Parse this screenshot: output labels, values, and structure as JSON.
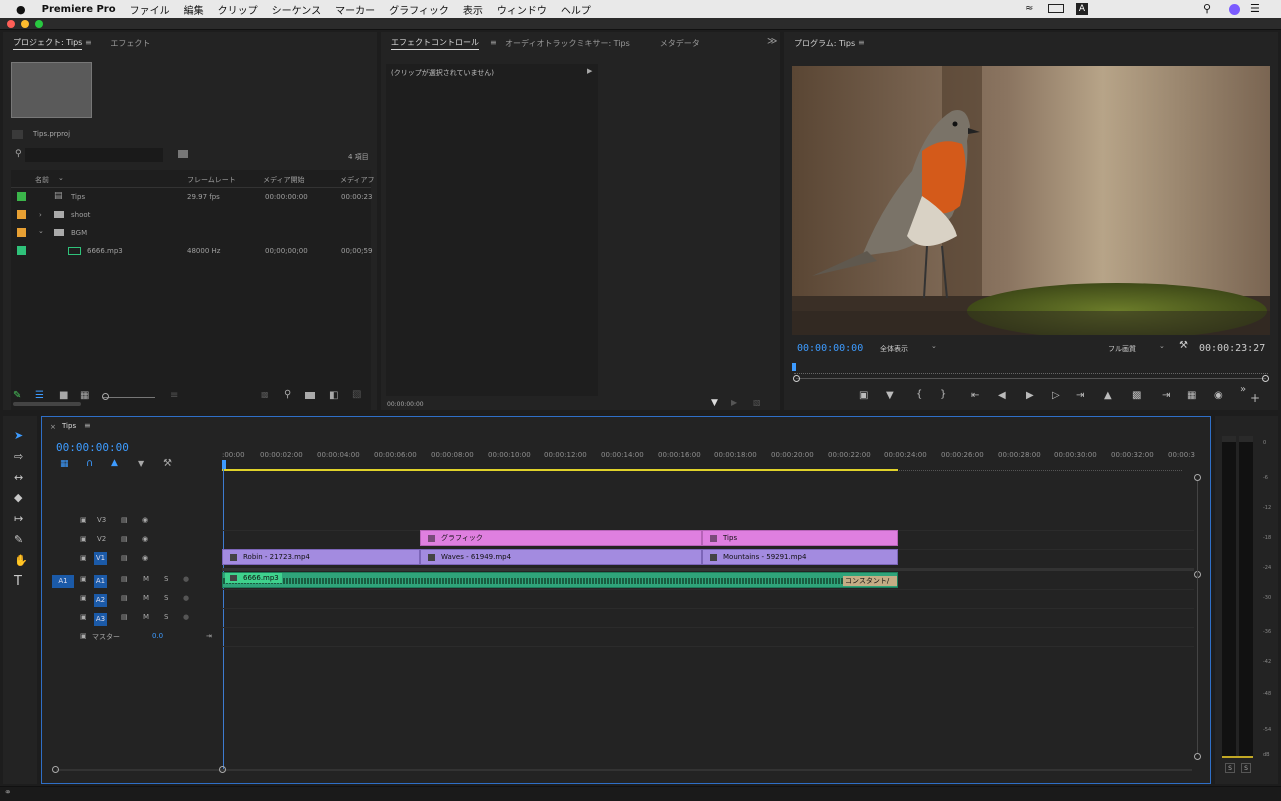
{
  "menubar": {
    "app": "Premiere Pro",
    "items": [
      "ファイル",
      "編集",
      "クリップ",
      "シーケンス",
      "マーカー",
      "グラフィック",
      "表示",
      "ウィンドウ",
      "ヘルプ"
    ]
  },
  "project": {
    "tabs": [
      "プロジェクト: Tips",
      "エフェクト"
    ],
    "filename": "Tips.prproj",
    "item_count": "4 項目",
    "columns": [
      "名前",
      "フレームレート",
      "メディア開始",
      "メディアフ"
    ],
    "rows": [
      {
        "name": "Tips",
        "fps": "29.97 fps",
        "start": "00:00:00:00",
        "end": "00:00:23",
        "color": "#3bb54a"
      },
      {
        "name": "shoot",
        "fps": "",
        "start": "",
        "end": "",
        "color": "#e8a033"
      },
      {
        "name": "BGM",
        "fps": "",
        "start": "",
        "end": "",
        "color": "#e8a033"
      },
      {
        "name": "6666.mp3",
        "fps": "48000 Hz",
        "start": "00;00;00;00",
        "end": "00;00;59",
        "color": "#2fc27a"
      }
    ]
  },
  "effects": {
    "tabs": [
      "エフェクトコントロール",
      "オーディオトラックミキサー: Tips",
      "メタデータ",
      "≫"
    ],
    "no_clip": "(クリップが選択されていません)",
    "timecode": "00:00:00:00"
  },
  "program": {
    "title": "プログラム: Tips",
    "timecode": "00:00:00:00",
    "zoom": "全体表示",
    "quality": "フル画質",
    "duration": "00:00:23:27"
  },
  "timeline": {
    "tab": "Tips",
    "timecode": "00:00:00:00",
    "ruler": [
      ":00:00",
      "00:00:02:00",
      "00:00:04:00",
      "00:00:06:00",
      "00:00:08:00",
      "00:00:10:00",
      "00:00:12:00",
      "00:00:14:00",
      "00:00:16:00",
      "00:00:18:00",
      "00:00:20:00",
      "00:00:22:00",
      "00:00:24:00",
      "00:00:26:00",
      "00:00:28:00",
      "00:00:30:00",
      "00:00:32:00",
      "00:00:3"
    ],
    "tracks": {
      "v3": "V3",
      "v2": "V2",
      "v1": "V1",
      "a1": "A1",
      "a2": "A2",
      "a3": "A3",
      "src_a1": "A1",
      "master": "マスター",
      "master_val": "0.0",
      "m": "M",
      "s": "S"
    },
    "clips": {
      "graphic": "グラフィック",
      "tips": "Tips",
      "robin": "Robin - 21723.mp4",
      "waves": "Waves - 61949.mp4",
      "mountains": "Mountains - 59291.mp4",
      "audio": "6666.mp3",
      "constant": "コンスタント/"
    }
  },
  "meter": {
    "scale": [
      "0",
      "-6",
      "-12",
      "-18",
      "-24",
      "-30",
      "-36",
      "-42",
      "-48",
      "-54",
      "dB"
    ],
    "s": "S"
  }
}
